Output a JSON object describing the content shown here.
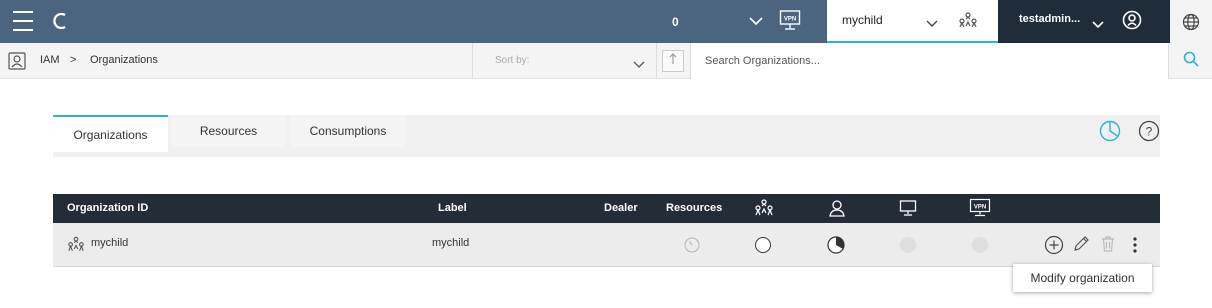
{
  "topbar": {
    "alert_count": "0",
    "vpn_icon_text": "VPN",
    "current_organization": "mychild",
    "user_name": "testadmin..."
  },
  "breadcrumb": {
    "root": "IAM",
    "separator": ">",
    "current": "Organizations"
  },
  "sort": {
    "label": "Sort by:"
  },
  "search": {
    "placeholder": "Search Organizations..."
  },
  "tabs": [
    {
      "label": "Organizations",
      "active": true
    },
    {
      "label": "Resources",
      "active": false
    },
    {
      "label": "Consumptions",
      "active": false
    }
  ],
  "table": {
    "headers": {
      "organization_id": "Organization ID",
      "label": "Label",
      "dealer": "Dealer",
      "resources": "Resources",
      "vpn_icon_text": "VPN"
    },
    "rows": [
      {
        "organization_id": "mychild",
        "label": "mychild"
      }
    ]
  },
  "tooltip": {
    "text": "Modify organization"
  },
  "colors": {
    "topbar_bg": "#4b6580",
    "accent": "#2bb3d8",
    "header_bg": "#222d38",
    "user_bg": "#1f2c3a"
  }
}
